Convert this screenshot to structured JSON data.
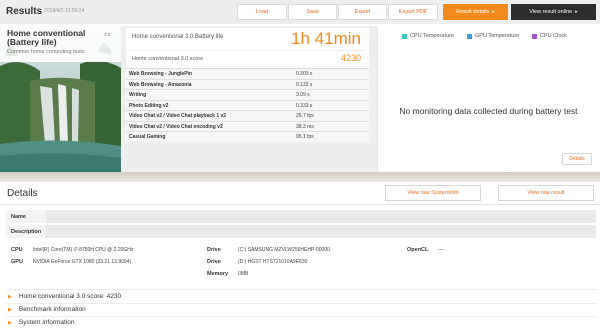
{
  "header": {
    "title": "Results",
    "date": "2018/4/2 13:56:24",
    "buttons": {
      "load": "Load",
      "save": "Save",
      "export": "Export",
      "export_pdf": "Export PDF",
      "result_details": "Result details",
      "view_online": "View result online"
    }
  },
  "benchmark": {
    "name": "Home conventional (Battery life)",
    "version": "3.0",
    "subtitle": "Common home computing tests"
  },
  "score_panel": {
    "battery_label": "Home conventional 3.0 Battery life",
    "battery_value": "1h 41min",
    "score_label": "Home conventional 3.0 score",
    "score_value": "4230",
    "subtests": [
      {
        "name": "Web Browsing - JunglePin",
        "value": "0.303 s"
      },
      {
        "name": "Web Browsing - Amazonia",
        "value": "0.132 s"
      },
      {
        "name": "Writing",
        "value": "3.09 s"
      },
      {
        "name": "Photo Editing v2",
        "value": "0.333 s"
      },
      {
        "name": "Video Chat v2 / Video Chat playback 1 v2",
        "value": "26.7 fps"
      },
      {
        "name": "Video Chat v2 / Video Chat encoding v2",
        "value": "38.3 ms"
      },
      {
        "name": "Casual Gaming",
        "value": "95.1 fps"
      }
    ]
  },
  "monitoring": {
    "legend": [
      {
        "label": "CPU Temperature",
        "color": "#3ec6c0"
      },
      {
        "label": "GPU Temperature",
        "color": "#3a9de0"
      },
      {
        "label": "CPU Clock",
        "color": "#a354c8"
      }
    ],
    "message": "No monitoring data collected during battery test",
    "details_button": "Details"
  },
  "details": {
    "title": "Details",
    "view_sysinfo": "View raw SystemInfo",
    "view_result": "View raw result",
    "name_label": "Name",
    "description_label": "Description",
    "specs": {
      "cpu_label": "CPU",
      "cpu_value": "Intel(R) Core(TM) i7-8750H CPU @ 2.20GHz",
      "gpu_label": "GPU",
      "gpu_value": "NVIDIA GeForce GTX 1080 (23.21.13.9094)",
      "drive_label": "Drive",
      "drive1_value": "(C:) SAMSUNG MZVLW256HEHP-00000",
      "drive2_value": "(D:) HGST HTS721010A9E630",
      "memory_label": "Memory",
      "memory_value": "0MB",
      "opencl_label": "OpenCL",
      "opencl_value": "----"
    },
    "sections": [
      "Home conventional 3.0 score: 4230",
      "Benchmark information",
      "System information"
    ]
  }
}
